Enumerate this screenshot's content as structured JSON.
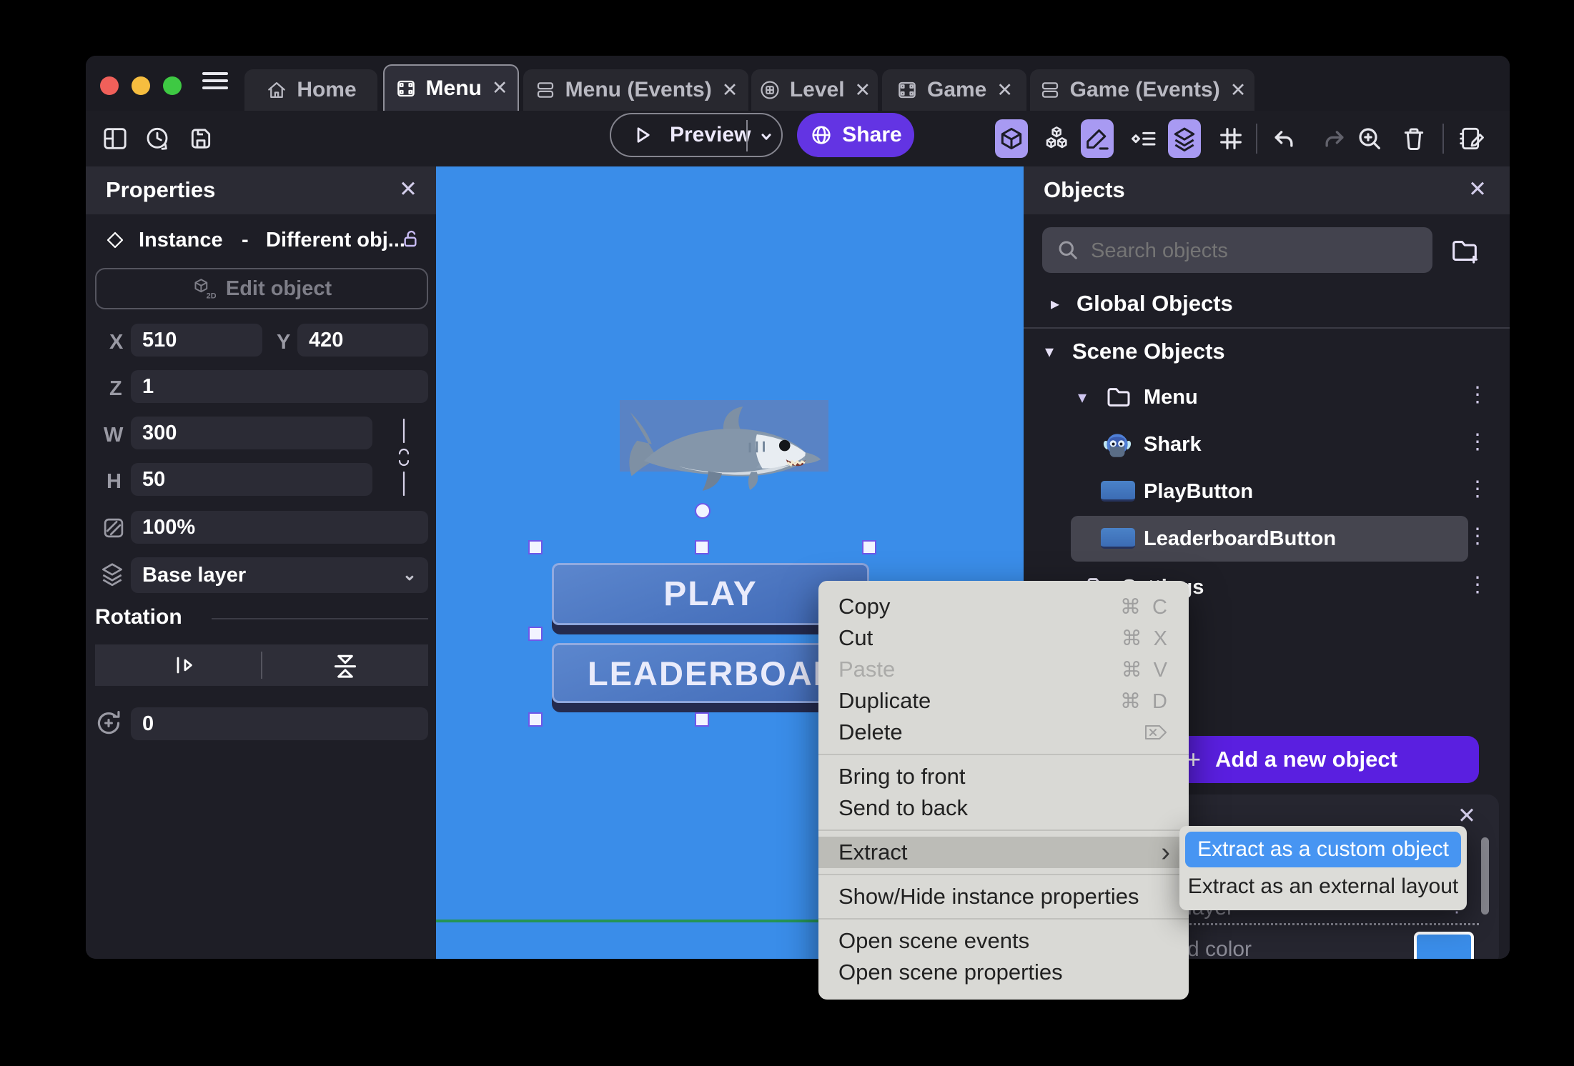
{
  "window": {
    "tabs": [
      {
        "label": "Home",
        "icon": "home-icon",
        "close": ""
      },
      {
        "label": "Menu",
        "icon": "film-icon",
        "close": "✕"
      },
      {
        "label": "Menu (Events)",
        "icon": "events-icon",
        "close": "✕"
      },
      {
        "label": "Level",
        "icon": "scene-icon",
        "close": "✕"
      },
      {
        "label": "Game",
        "icon": "film-icon",
        "close": "✕"
      },
      {
        "label": "Game (Events)",
        "icon": "events-icon",
        "close": "✕"
      }
    ],
    "toolbar": {
      "preview_label": "Preview",
      "share_label": "Share"
    }
  },
  "properties_panel": {
    "title": "Properties",
    "close": "✕",
    "instance_type": "Instance",
    "instance_sep": "-",
    "instance_name": "Different obj...",
    "edit_object_label": "Edit object",
    "x_label": "X",
    "x_value": "510",
    "y_label": "Y",
    "y_value": "420",
    "z_label": "Z",
    "z_value": "1",
    "w_label": "W",
    "w_value": "300",
    "h_label": "H",
    "h_value": "50",
    "opacity_value": "100%",
    "layer_value": "Base layer",
    "rotation_title": "Rotation",
    "rotation_value": "0"
  },
  "canvas": {
    "play_label": "PLAY",
    "leaderboard_label": "LEADERBOARD"
  },
  "context_menu": {
    "items": [
      {
        "label": "Copy",
        "shortcut": "⌘ C"
      },
      {
        "label": "Cut",
        "shortcut": "⌘ X"
      },
      {
        "label": "Paste",
        "shortcut": "⌘ V",
        "disabled": true
      },
      {
        "label": "Duplicate",
        "shortcut": "⌘ D"
      },
      {
        "label": "Delete",
        "shortcut_icon": "delete-key-icon"
      },
      {
        "type": "separator"
      },
      {
        "label": "Bring to front"
      },
      {
        "label": "Send to back"
      },
      {
        "type": "separator"
      },
      {
        "label": "Extract",
        "highlighted": true,
        "submenu_arrow": "›"
      },
      {
        "type": "separator"
      },
      {
        "label": "Show/Hide instance properties"
      },
      {
        "type": "separator"
      },
      {
        "label": "Open scene events"
      },
      {
        "label": "Open scene properties"
      }
    ]
  },
  "extract_submenu": {
    "items": [
      {
        "label": "Extract as a custom object",
        "highlighted": true
      },
      {
        "label": "Extract as an external layout"
      }
    ]
  },
  "objects_panel": {
    "title": "Objects",
    "close": "✕",
    "search_placeholder": "Search objects",
    "global_section": "Global Objects",
    "scene_section": "Scene Objects",
    "tree": [
      {
        "label": "Menu",
        "type": "folder"
      },
      {
        "label": "Shark",
        "type": "object"
      },
      {
        "label": "PlayButton",
        "type": "object"
      },
      {
        "label": "LeaderboardButton",
        "type": "object",
        "selected": true
      },
      {
        "label": "Settings",
        "type": "folder"
      }
    ],
    "add_button_label": "Add a new object",
    "bottom_panel": {
      "close": "✕",
      "layer_text_fragment": "layer",
      "color_text_fragment": "d color"
    }
  },
  "colors": {
    "accent_purple": "#6334e3",
    "add_button_purple": "#5a1fe0",
    "canvas_blue": "#3a8de9",
    "submenu_highlight_blue": "#4795f2",
    "selection_handle_purple": "#6f57e8",
    "toolbar_active_bg": "#a89af2",
    "green_guide_line": "#259455",
    "swatch_blue": "#3a8de9"
  }
}
